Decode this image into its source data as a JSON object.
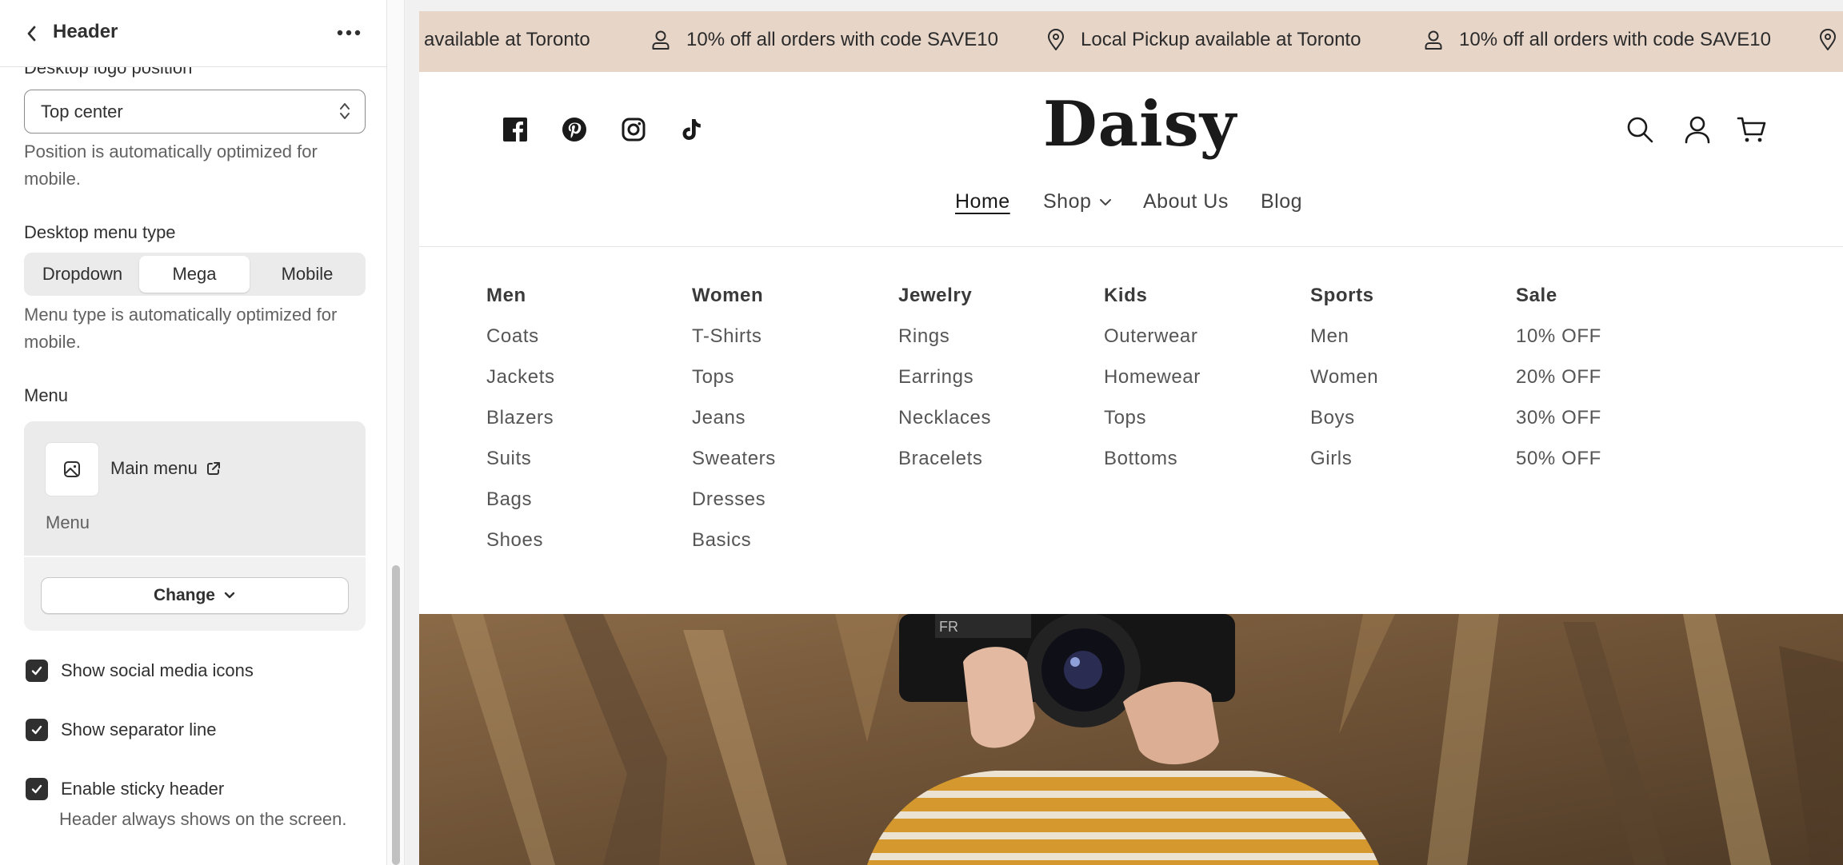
{
  "panel": {
    "title": "Header",
    "logo_position": {
      "label": "Desktop logo position",
      "value": "Top center",
      "help": "Position is automatically optimized for mobile."
    },
    "menu_type": {
      "label": "Desktop menu type",
      "options": [
        "Dropdown",
        "Mega",
        "Mobile"
      ],
      "selected": "Mega",
      "help": "Menu type is automatically optimized for mobile."
    },
    "menu": {
      "label": "Menu",
      "link_text": "Main menu",
      "subtitle": "Menu",
      "change_label": "Change"
    },
    "checkboxes": {
      "social": "Show social media icons",
      "separator": "Show separator line",
      "sticky": "Enable sticky header",
      "sticky_help": "Header always shows on the screen."
    }
  },
  "preview": {
    "announcement": {
      "pickup_text": "Local Pickup available at Toronto",
      "pickup_partial": "available at Toronto",
      "discount_text": "10% off all orders with code SAVE10",
      "background": "#e7d5c8"
    },
    "logo": "Daisy",
    "social_icons": [
      "facebook-icon",
      "pinterest-icon",
      "instagram-icon",
      "tiktok-icon"
    ],
    "nav": {
      "home": "Home",
      "shop": "Shop",
      "about": "About Us",
      "blog": "Blog"
    },
    "mega_menu": [
      {
        "heading": "Men",
        "links": [
          "Coats",
          "Jackets",
          "Blazers",
          "Suits",
          "Bags",
          "Shoes"
        ]
      },
      {
        "heading": "Women",
        "links": [
          "T-Shirts",
          "Tops",
          "Jeans",
          "Sweaters",
          "Dresses",
          "Basics"
        ]
      },
      {
        "heading": "Jewelry",
        "links": [
          "Rings",
          "Earrings",
          "Necklaces",
          "Bracelets"
        ]
      },
      {
        "heading": "Kids",
        "links": [
          "Outerwear",
          "Homewear",
          "Tops",
          "Bottoms"
        ]
      },
      {
        "heading": "Sports",
        "links": [
          "Men",
          "Women",
          "Boys",
          "Girls"
        ]
      },
      {
        "heading": "Sale",
        "links": [
          "10% OFF",
          "20% OFF",
          "30% OFF",
          "50% OFF"
        ]
      }
    ]
  }
}
